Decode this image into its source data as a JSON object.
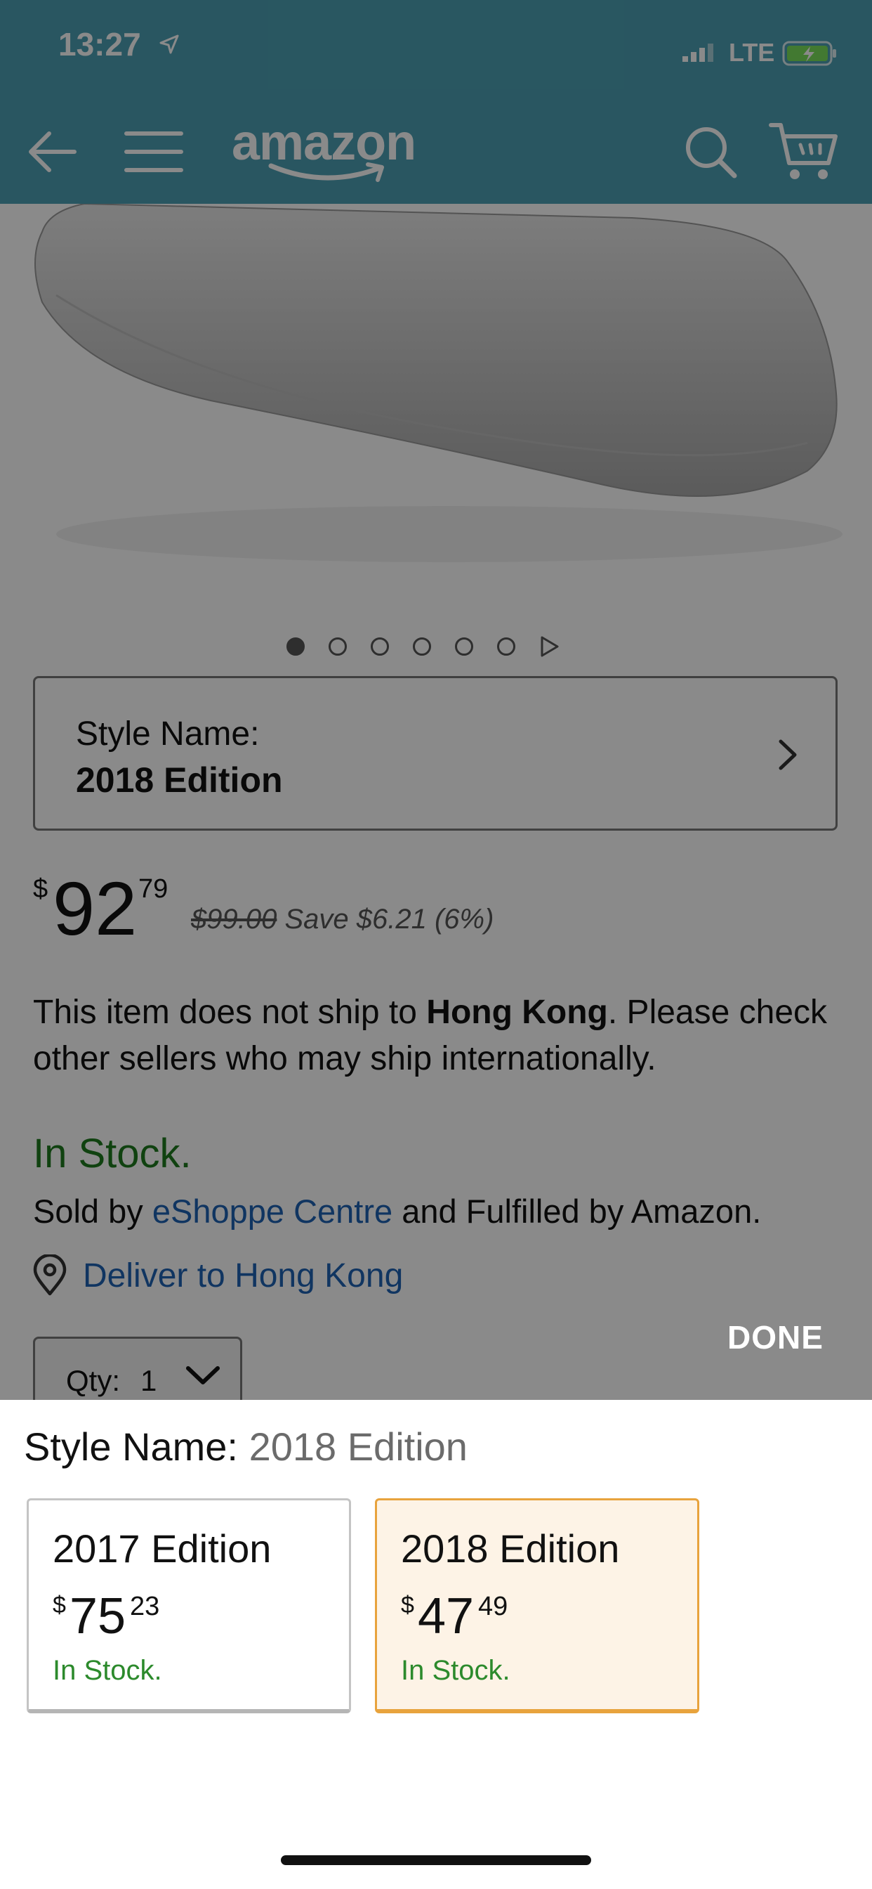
{
  "status_bar": {
    "time": "13:27",
    "network": "LTE"
  },
  "nav": {
    "logo_text": "amazon"
  },
  "product": {
    "image_dots": {
      "total": 6,
      "active_index": 0
    },
    "style_selector": {
      "label": "Style Name:",
      "value": "2018 Edition"
    },
    "price": {
      "currency": "$",
      "whole": "92",
      "fraction": "79",
      "list_price": "$99.00",
      "savings": "Save $6.21 (6%)"
    },
    "shipping": {
      "before": "This item does not ship to ",
      "region": "Hong Kong",
      "after": ". Please check other sellers who may ship internationally."
    },
    "availability": "In Stock.",
    "sold_by": {
      "prefix": "Sold by ",
      "seller": "eShoppe Centre",
      "suffix": " and Fulfilled by Amazon."
    },
    "deliver_to": "Deliver to Hong Kong",
    "quantity": {
      "label": "Qty:",
      "value": "1"
    }
  },
  "sheet": {
    "done_label": "DONE",
    "title_label": "Style Name: ",
    "title_selected": "2018 Edition",
    "options": [
      {
        "name": "2017 Edition",
        "currency": "$",
        "whole": "75",
        "fraction": "23",
        "stock": "In Stock.",
        "selected": false
      },
      {
        "name": "2018 Edition",
        "currency": "$",
        "whole": "47",
        "fraction": "49",
        "stock": "In Stock.",
        "selected": true
      }
    ]
  },
  "colors": {
    "header": "#4ca0b3",
    "link": "#1e62b4",
    "in_stock": "#1f7a1f",
    "selected_border": "#e8a33d",
    "selected_bg": "#fdf3e6"
  }
}
